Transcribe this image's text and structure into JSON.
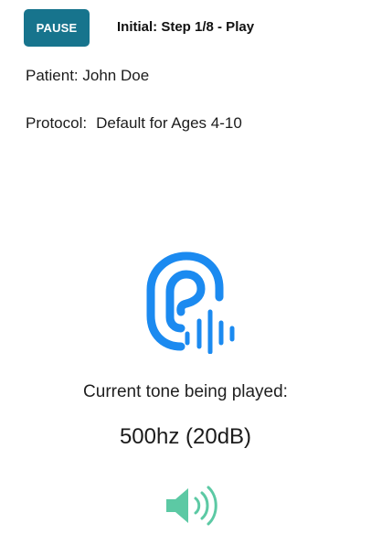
{
  "header": {
    "pause_label": "PAUSE",
    "step_label": "Initial: Step 1/8 - Play"
  },
  "patient": {
    "label": "Patient:",
    "name": "John Doe"
  },
  "protocol": {
    "label": "Protocol:",
    "name": "Default for Ages 4-10"
  },
  "tone": {
    "caption": "Current tone being played:",
    "value": "500hz (20dB)"
  },
  "icons": {
    "hearing": "ear-sound-icon",
    "speaker": "speaker-volume-icon"
  },
  "colors": {
    "pause_button": "#17748d",
    "ear_icon": "#1b8af0",
    "speaker_icon": "#5cc9a4"
  }
}
